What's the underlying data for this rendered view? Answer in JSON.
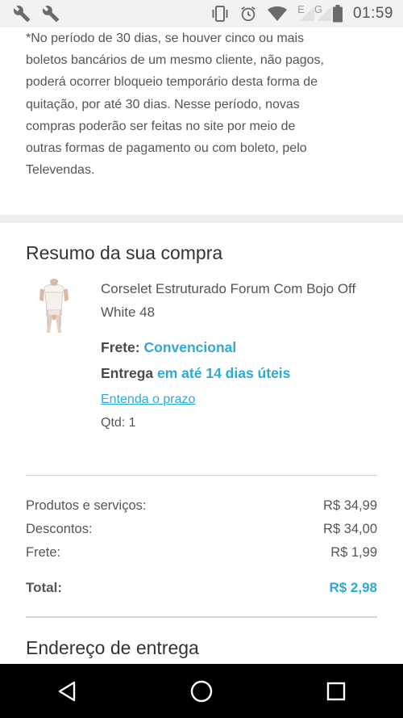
{
  "status_bar": {
    "time": "01:59",
    "left_icons": [
      "wrench-icon",
      "wrench-icon"
    ],
    "right_icons": [
      "vibrate-icon",
      "alarm-icon",
      "wifi-icon",
      "signal-e-icon",
      "signal-g-icon",
      "battery-icon"
    ],
    "network_e": "E",
    "network_g": "G"
  },
  "notice": {
    "text": "*No período de 30 dias, se houver cinco ou mais\nboletos bancários de um mesmo cliente, não pagos,\npoderá ocorrer bloqueio temporário desta forma de\nquitação, por até 30 dias. Nesse período, novas\ncompras poderão ser feitas no site por meio de\noutras formas de pagamento ou com boleto, pelo\nTelevendas."
  },
  "summary": {
    "title": "Resumo da sua compra",
    "product": {
      "name": "Corselet Estruturado Forum Com Bojo Off White 48",
      "frete_label": "Frete:",
      "frete_value": "Convencional",
      "entrega_label": "Entrega",
      "entrega_value": "em até 14 dias úteis",
      "prazo_link": "Entenda o prazo",
      "qtd": "Qtd: 1"
    },
    "rows": [
      {
        "label": "Produtos e serviços:",
        "value": "R$ 34,99"
      },
      {
        "label": "Descontos:",
        "value": "R$ 34,00"
      },
      {
        "label": "Frete:",
        "value": "R$ 1,99"
      }
    ],
    "total_label": "Total:",
    "total_value": "R$ 2,98"
  },
  "address": {
    "title": "Endereço de entrega"
  },
  "colors": {
    "accent": "#2aaad6",
    "text": "#555555",
    "navbar": "#000000"
  },
  "navbar": {
    "buttons": [
      "back-icon",
      "home-icon",
      "recents-icon"
    ]
  }
}
